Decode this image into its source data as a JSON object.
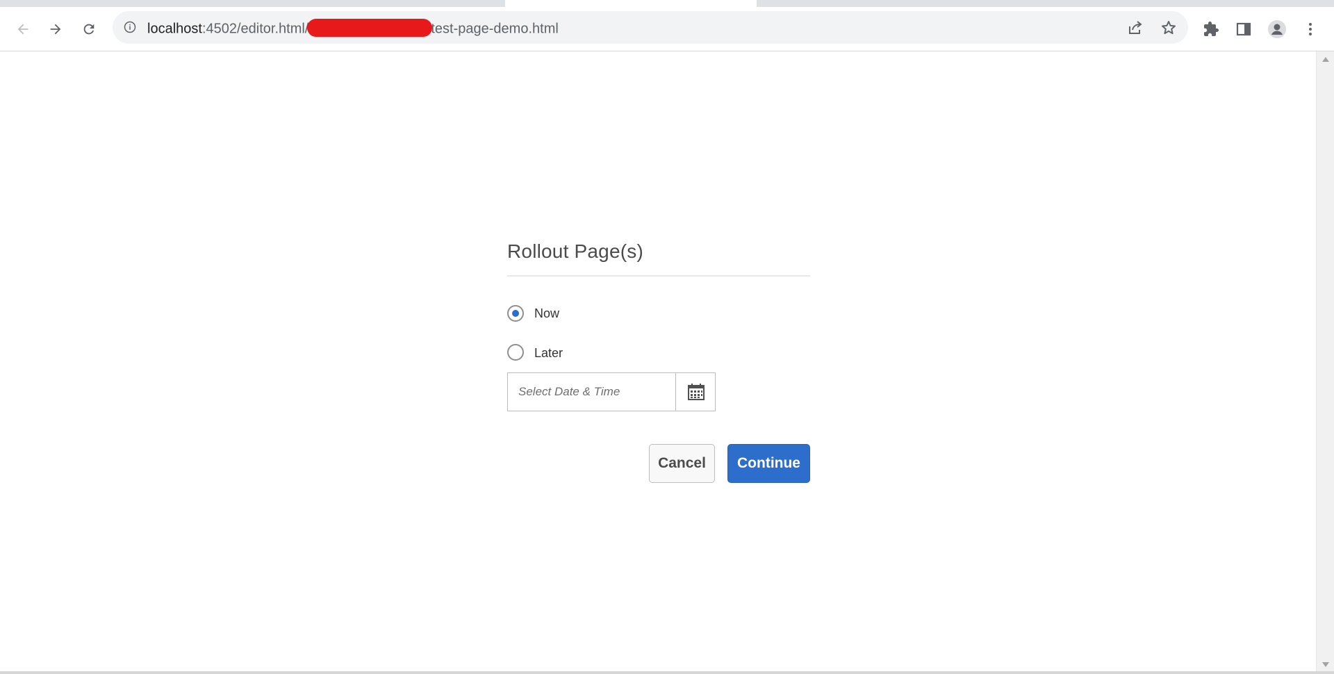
{
  "browser": {
    "url_host": "localhost",
    "url_path_start": ":4502/editor.html/",
    "url_path_end": "test-page-demo.html"
  },
  "dialog": {
    "title": "Rollout Page(s)",
    "options": [
      {
        "label": "Now",
        "selected": true
      },
      {
        "label": "Later",
        "selected": false
      }
    ],
    "datetime_placeholder": "Select Date & Time",
    "cancel_label": "Cancel",
    "continue_label": "Continue"
  },
  "colors": {
    "accent": "#2d6ecc",
    "redaction": "#e8191b"
  }
}
